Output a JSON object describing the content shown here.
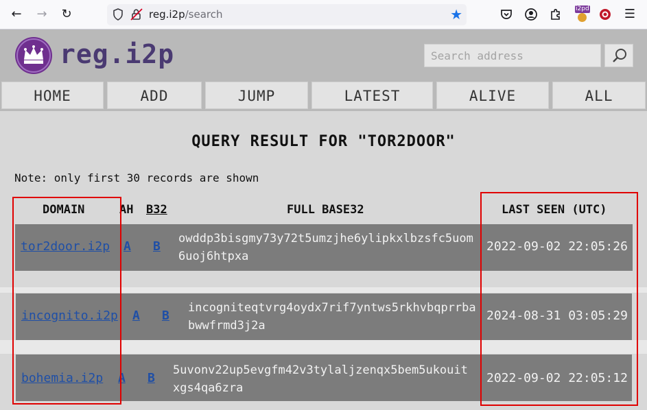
{
  "browser": {
    "url_host": "reg.i2p",
    "url_path": "/search",
    "extension_badge": "i2pd"
  },
  "site": {
    "name": "reg.i2p",
    "search_placeholder": "Search address"
  },
  "menu": [
    "HOME",
    "ADD",
    "JUMP",
    "LATEST",
    "ALIVE",
    "ALL"
  ],
  "title": "QUERY RESULT FOR \"TOR2DOOR\"",
  "note": "Note: only first 30 records are shown",
  "table": {
    "headers": {
      "domain": "DOMAIN",
      "ah": "AH",
      "b32": "B32",
      "full_base32": "FULL BASE32",
      "last_seen": "LAST SEEN (UTC)"
    },
    "rows": [
      {
        "domain": "tor2door.i2p",
        "ah": "A",
        "b32": "B",
        "full_base32": "owddp3bisgmy73y72t5umzjhe6ylipkxlbzsfc5uom6uoj6htpxa",
        "last_seen": "2022-09-02 22:05:26"
      },
      {
        "domain": "incognito.i2p",
        "ah": "A",
        "b32": "B",
        "full_base32": "incogniteqtvrg4oydx7rif7yntws5rkhvbqprrbabwwfrmd3j2a",
        "last_seen": "2024-08-31 03:05:29"
      },
      {
        "domain": "bohemia.i2p",
        "ah": "A",
        "b32": "B",
        "full_base32": "5uvonv22up5evgfm42v3tylaljzenqx5bem5ukouitxgs4qa6zra",
        "last_seen": "2022-09-02 22:05:12"
      }
    ]
  },
  "colors": {
    "row_bg": "#7c7c7c",
    "link": "#1f4fa6",
    "highlight": "#e00000",
    "logo": "#6f2f8f"
  }
}
